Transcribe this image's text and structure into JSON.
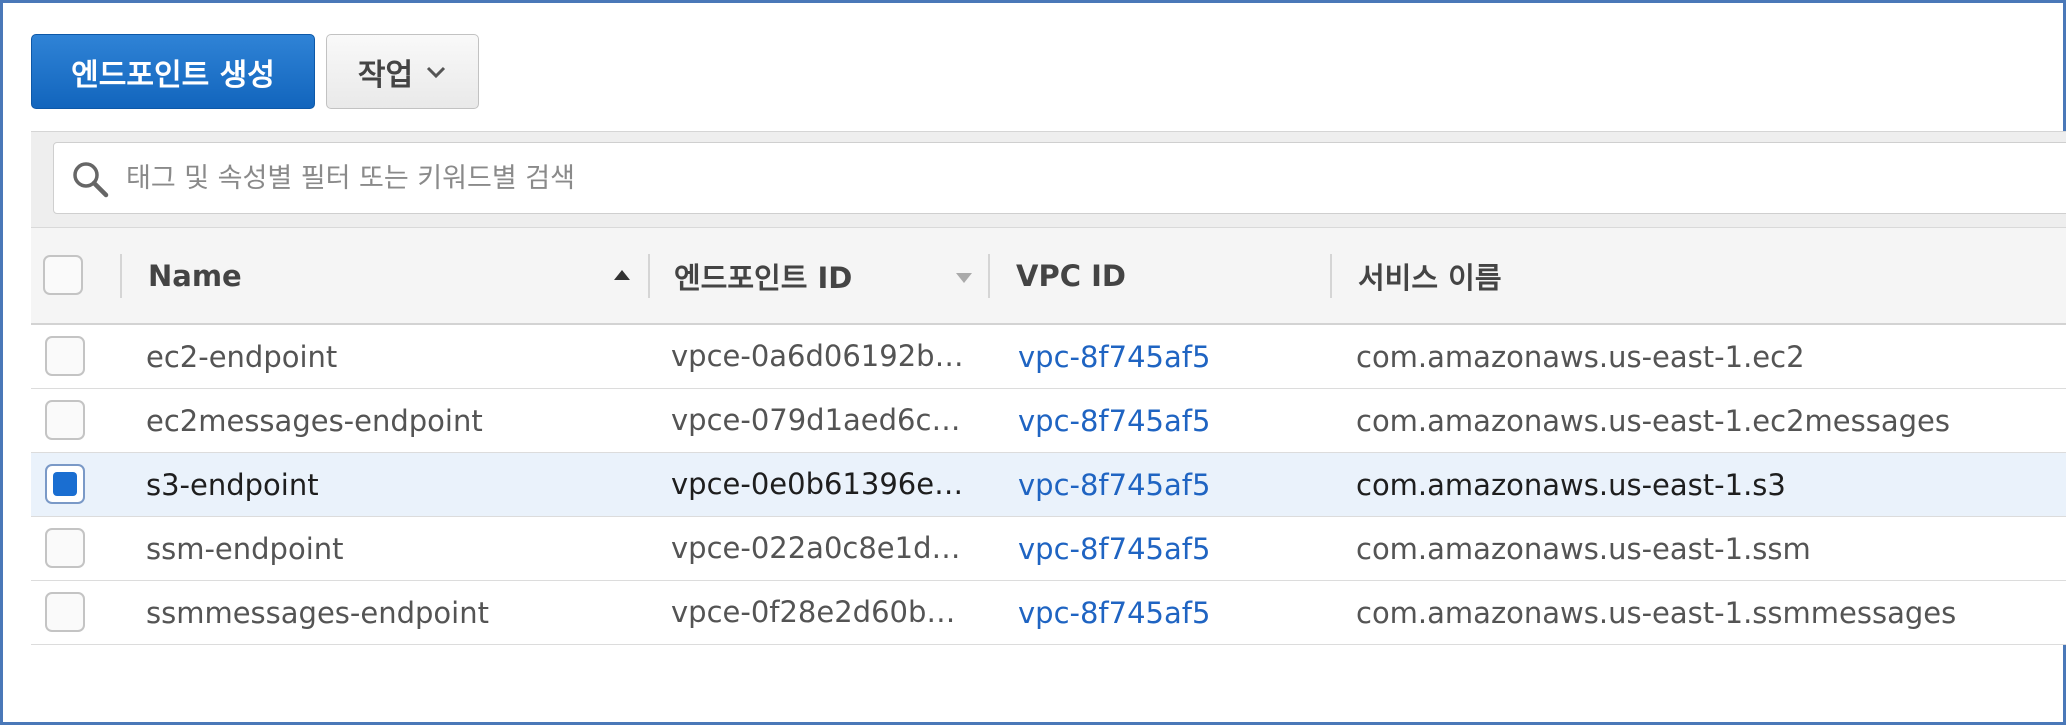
{
  "toolbar": {
    "create_label": "엔드포인트 생성",
    "actions_label": "작업"
  },
  "search": {
    "placeholder": "태그 및 속성별 필터 또는 키워드별 검색"
  },
  "table": {
    "columns": {
      "name": "Name",
      "endpoint_id": "엔드포인트 ID",
      "vpc_id": "VPC ID",
      "service_name": "서비스 이름"
    },
    "sort": {
      "column": "Name",
      "direction": "ascending"
    },
    "rows": [
      {
        "name": "ec2-endpoint",
        "endpoint_id": "vpce-0a6d06192b…",
        "vpc_id": "vpc-8f745af5",
        "service_name": "com.amazonaws.us-east-1.ec2",
        "selected": false
      },
      {
        "name": "ec2messages-endpoint",
        "endpoint_id": "vpce-079d1aed6c…",
        "vpc_id": "vpc-8f745af5",
        "service_name": "com.amazonaws.us-east-1.ec2messages",
        "selected": false
      },
      {
        "name": "s3-endpoint",
        "endpoint_id": "vpce-0e0b61396e…",
        "vpc_id": "vpc-8f745af5",
        "service_name": "com.amazonaws.us-east-1.s3",
        "selected": true
      },
      {
        "name": "ssm-endpoint",
        "endpoint_id": "vpce-022a0c8e1d…",
        "vpc_id": "vpc-8f745af5",
        "service_name": "com.amazonaws.us-east-1.ssm",
        "selected": false
      },
      {
        "name": "ssmmessages-endpoint",
        "endpoint_id": "vpce-0f28e2d60b5…",
        "vpc_id": "vpc-8f745af5",
        "service_name": "com.amazonaws.us-east-1.ssmmessages",
        "selected": false
      }
    ]
  },
  "colors": {
    "primary_button": "#1a6ed1",
    "link": "#1f64c2",
    "selected_row": "#eaf2fb",
    "frame_border": "#4a78b8"
  },
  "icons": {
    "search": "search-icon",
    "dropdown": "chevron-down-icon"
  }
}
